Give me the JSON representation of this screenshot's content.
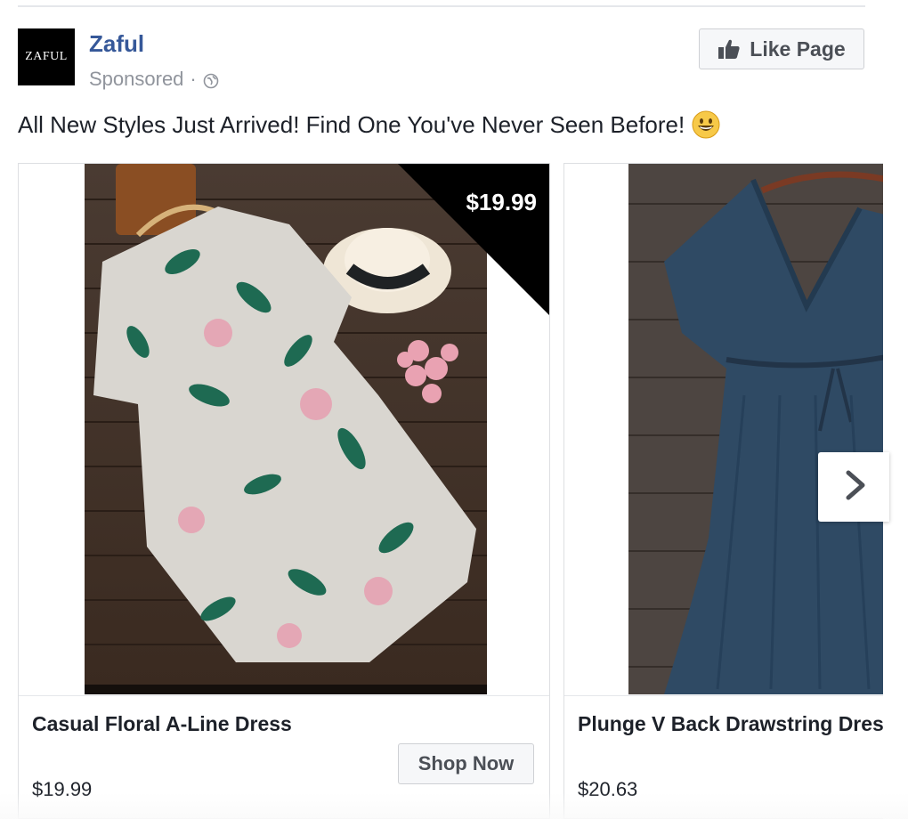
{
  "post": {
    "page_name": "Zaful",
    "logo_text": "ZAFUL",
    "sponsored_label": "Sponsored",
    "meta_separator": "·",
    "like_button_label": "Like Page",
    "caption": "All New Styles Just Arrived! Find One You've Never Seen Before!"
  },
  "carousel": {
    "cards": [
      {
        "title": "Casual Floral A-Line Dress",
        "price": "$19.99",
        "corner_price": "$19.99",
        "cta_label": "Shop Now",
        "image_icon": "floral-dress-image"
      },
      {
        "title": "Plunge V Back Drawstring Dress",
        "price": "$20.63",
        "image_icon": "navy-dress-image"
      }
    ]
  },
  "colors": {
    "page_name": "#365899",
    "secondary_text": "#90949c",
    "button_bg": "#f6f7f9",
    "border": "#dddfe2"
  }
}
